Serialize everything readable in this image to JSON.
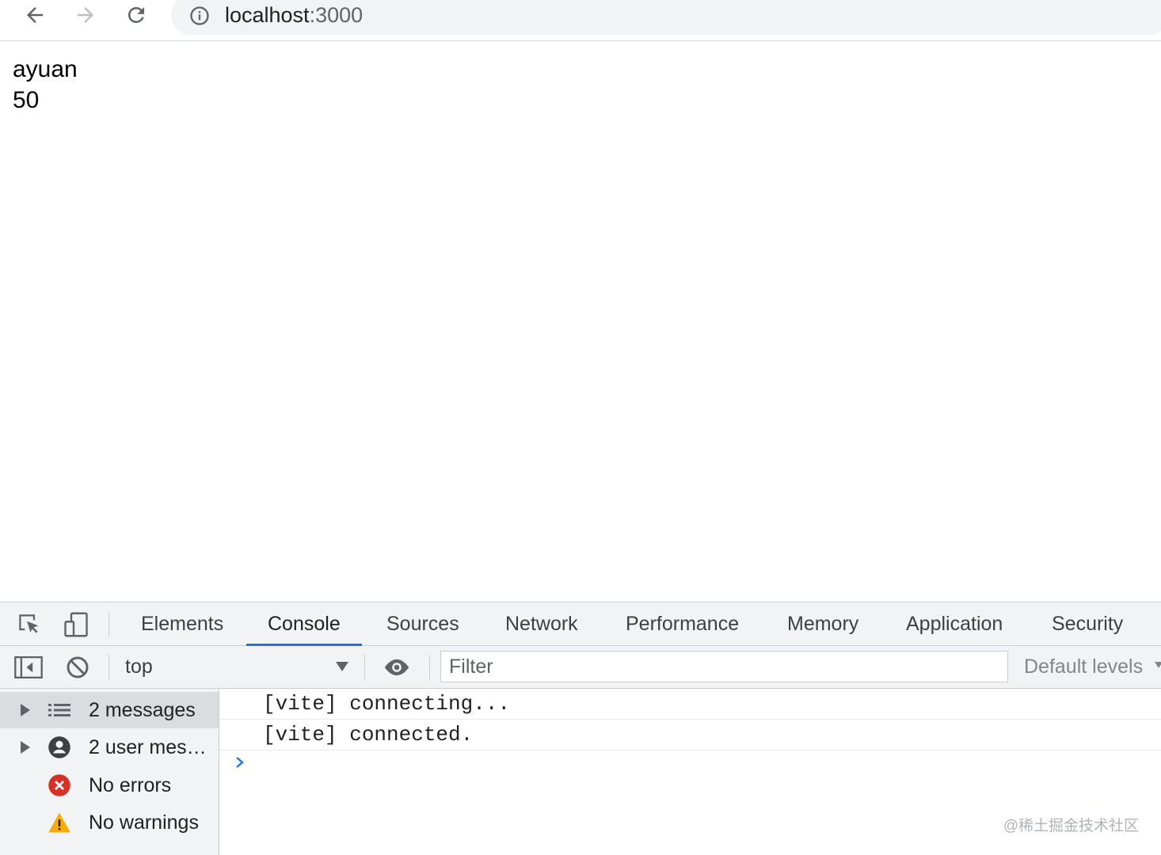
{
  "browser": {
    "back_icon": "arrow-left-icon",
    "forward_icon": "arrow-right-icon",
    "reload_icon": "reload-icon",
    "site_info_icon": "info-icon",
    "url_host": "localhost",
    "url_port": ":3000"
  },
  "page": {
    "lines": [
      "ayuan",
      "50"
    ]
  },
  "devtools": {
    "tabs": [
      "Elements",
      "Console",
      "Sources",
      "Network",
      "Performance",
      "Memory",
      "Application",
      "Security"
    ],
    "active_tab": "Console",
    "console_toolbar": {
      "context": "top",
      "filter_placeholder": "Filter",
      "levels": "Default levels"
    },
    "sidebar": [
      {
        "label": "2 messages",
        "icon": "list-icon",
        "expandable": true,
        "selected": true
      },
      {
        "label": "2 user mes…",
        "icon": "user-icon",
        "expandable": true,
        "selected": false
      },
      {
        "label": "No errors",
        "icon": "error-icon",
        "expandable": false,
        "selected": false
      },
      {
        "label": "No warnings",
        "icon": "warning-icon",
        "expandable": false,
        "selected": false
      }
    ],
    "messages": [
      "[vite] connecting...",
      "[vite] connected."
    ]
  },
  "watermark": "@稀土掘金技术社区",
  "colors": {
    "accent": "#1a73e8",
    "error": "#d93025",
    "warning": "#f9ab00",
    "chrome_bg": "#f1f3f4"
  }
}
